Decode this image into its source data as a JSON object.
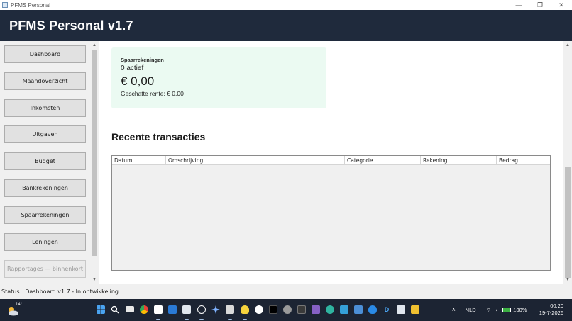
{
  "window": {
    "title": "PFMS Personal",
    "controls": [
      "—",
      "❐",
      "✕"
    ]
  },
  "header": {
    "title": "PFMS Personal v1.7"
  },
  "sidebar": {
    "items": [
      {
        "label": "Dashboard",
        "enabled": true
      },
      {
        "label": "Maandoverzicht",
        "enabled": true
      },
      {
        "label": "Inkomsten",
        "enabled": true
      },
      {
        "label": "Uitgaven",
        "enabled": true
      },
      {
        "label": "Budget",
        "enabled": true
      },
      {
        "label": "Bankrekeningen",
        "enabled": true
      },
      {
        "label": "Spaarrekeningen",
        "enabled": true
      },
      {
        "label": "Leningen",
        "enabled": true
      },
      {
        "label": "Rapportages — binnenkort",
        "enabled": false
      }
    ]
  },
  "savings_card": {
    "title": "Spaarrekeningen",
    "active_count": "0 actief",
    "amount": "€ 0,00",
    "interest": "Geschatte rente: € 0,00",
    "bg_color": "#ebfaf2"
  },
  "transactions": {
    "title": "Recente transacties",
    "columns": [
      "Datum",
      "Omschrijving",
      "Categorie",
      "Rekening",
      "Bedrag"
    ],
    "rows": []
  },
  "status": {
    "text": "Status : Dashboard v1.7 - In ontwikkeling"
  },
  "taskbar": {
    "weather_temp": "14°",
    "language": "NLD",
    "battery": "100%",
    "time": "00:20",
    "date": "19-7-2026"
  },
  "colors": {
    "header_bg": "#1f2a3c",
    "taskbar_bg": "#1c2433"
  }
}
